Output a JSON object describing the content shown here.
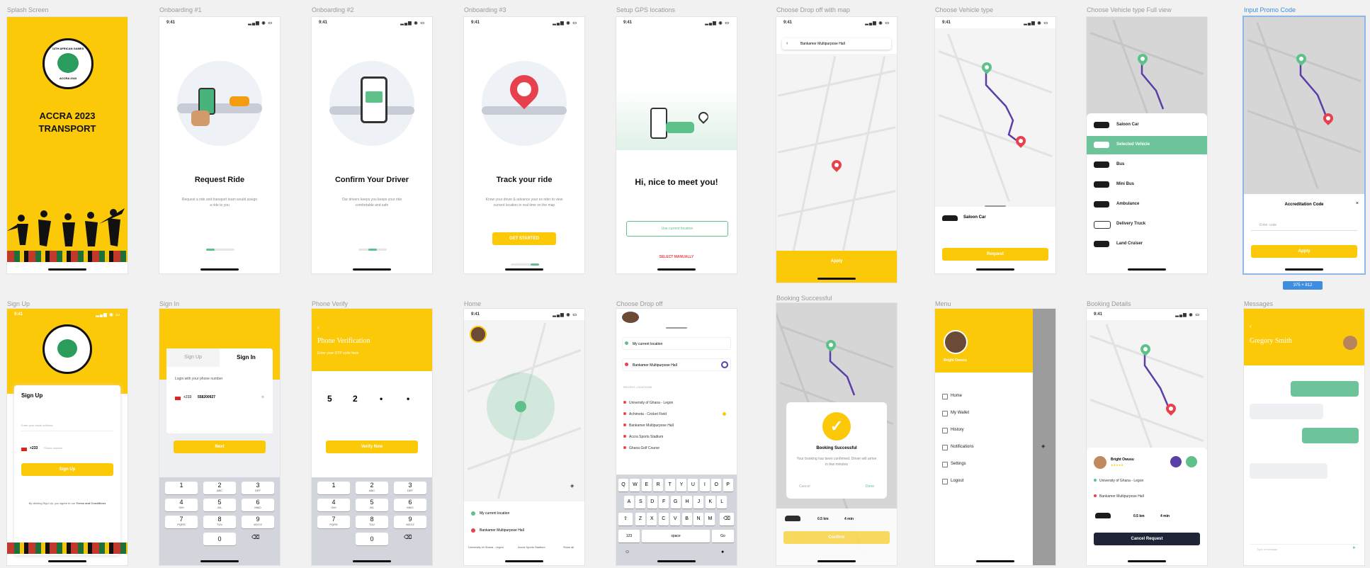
{
  "labels": {
    "splash": "Splash Screen",
    "onb1": "Onboarding #1",
    "onb2": "Onboarding #2",
    "onb3": "Onboarding #3",
    "gps": "Setup GPS locations",
    "pickup": "Choose Drop off with map",
    "vehicle": "Choose Vehicle type",
    "vehicle_full": "Choose Vehicle type Full view",
    "promo": "Input Promo Code",
    "signup": "Sign Up",
    "signin": "Sign In",
    "phone": "Phone Verify",
    "home": "Home",
    "dropoff": "Choose Drop off",
    "booking_ok": "Booking Successful",
    "menu": "Menu",
    "booking_det": "Booking Details",
    "messages": "Messages"
  },
  "status": {
    "time": "9:41",
    "signal": "▂▄▆ ◉ ▭"
  },
  "splash": {
    "title_line1": "ACCRA 2023",
    "title_line2": "TRANSPORT",
    "logo_top": "13TH AFRICAN GAMES",
    "logo_bottom": "ACCRA 2023"
  },
  "onb1": {
    "title": "Request Ride",
    "desc": "Request a ride and transport team would assign a ride to you"
  },
  "onb2": {
    "title": "Confirm Your Driver",
    "desc": "Our drivers keeps you keeps your ride comfortable and safe"
  },
  "onb3": {
    "title": "Track your ride",
    "desc": "Know your driver & advance your ex rider to view current location in real time on the map",
    "button": "GET STARTED"
  },
  "gps": {
    "title": "Hi, nice to meet you!",
    "button": "Use current location",
    "link": "SELECT MANUALLY"
  },
  "pickup": {
    "search": "Bankamer Multipurpose Hall",
    "button": "Apply"
  },
  "vehicle": {
    "car": "Saloon Car",
    "button": "Request"
  },
  "vehicle_full": {
    "items": [
      "Saloon Car",
      "Selected Vehicle",
      "Bus",
      "Mini Bus",
      "Ambulance",
      "Delivery Truck",
      "Land Cruiser"
    ]
  },
  "promo": {
    "title": "Accreditation Code",
    "placeholder": "Enter code",
    "button": "Apply",
    "size_badge": "375 × 812"
  },
  "signup": {
    "title": "Sign Up",
    "email_ph": "Enter your email address",
    "code": "+233",
    "phone_ph": "Phone number",
    "button": "Sign Up",
    "terms_pre": "By clicking Sign Up, you agree to our",
    "terms_link": "Terms and Conditions"
  },
  "signin": {
    "tab_up": "Sign Up",
    "tab_in": "Sign In",
    "prompt": "Login with your phone number",
    "code": "+233",
    "phone": "558200927",
    "button": "Next"
  },
  "phone": {
    "title": "Phone Verification",
    "sub": "Enter your OTP code here",
    "d1": "5",
    "d2": "2",
    "d3": "•",
    "d4": "•",
    "button": "Verify Now"
  },
  "keypad": [
    {
      "n": "1",
      "l": ""
    },
    {
      "n": "2",
      "l": "ABC"
    },
    {
      "n": "3",
      "l": "DEF"
    },
    {
      "n": "4",
      "l": "GHI"
    },
    {
      "n": "5",
      "l": "JKL"
    },
    {
      "n": "6",
      "l": "MNO"
    },
    {
      "n": "7",
      "l": "PQRS"
    },
    {
      "n": "8",
      "l": "TUV"
    },
    {
      "n": "9",
      "l": "WXYZ"
    },
    {
      "n": "0",
      "l": ""
    }
  ],
  "home": {
    "current": "My current location",
    "dest": "Bankamer Multipurpose Hall",
    "tabs": [
      "University of Ghana - Legon",
      "Accra Sports Stadium",
      "Show all"
    ]
  },
  "dropoff": {
    "current": "My current location",
    "dest": "Bankamer Multipurpose Hall",
    "recent_label": "RECENT LOCATIONS",
    "items": [
      "University of Ghana - Legon",
      "Achimota - Cricket Field",
      "Bankamer Multipurpose Hall",
      "Accra Sports Stadium",
      "Ghana Golf Course"
    ],
    "kb_row1": [
      "Q",
      "W",
      "E",
      "R",
      "T",
      "Y",
      "U",
      "I",
      "O",
      "P"
    ],
    "kb_row2": [
      "A",
      "S",
      "D",
      "F",
      "G",
      "H",
      "J",
      "K",
      "L"
    ],
    "kb_row3": [
      "Z",
      "X",
      "C",
      "V",
      "B",
      "N",
      "M"
    ],
    "space": "space",
    "go": "Go",
    "num": "123"
  },
  "booking_ok": {
    "title": "Booking Successful",
    "desc": "Your booking has been confirmed. Driver will arrive in few minutes",
    "cancel": "Cancel",
    "done": "Done",
    "time_v": "4 min",
    "dist_v": "0.5 km",
    "button": "Confirm"
  },
  "menu": {
    "name": "Bright Owusu",
    "items": [
      "Home",
      "My Wallet",
      "History",
      "Notifications",
      "Settings",
      "Logout"
    ]
  },
  "booking_det": {
    "driver": "Bright Owusu",
    "from": "University of Ghana - Legon",
    "to": "Bankamer Multipurpose Hall",
    "dist": "0.5 km",
    "time": "4 min",
    "button": "Cancel Request"
  },
  "messages": {
    "name": "Gregory Smith",
    "input_ph": "Type a message"
  }
}
